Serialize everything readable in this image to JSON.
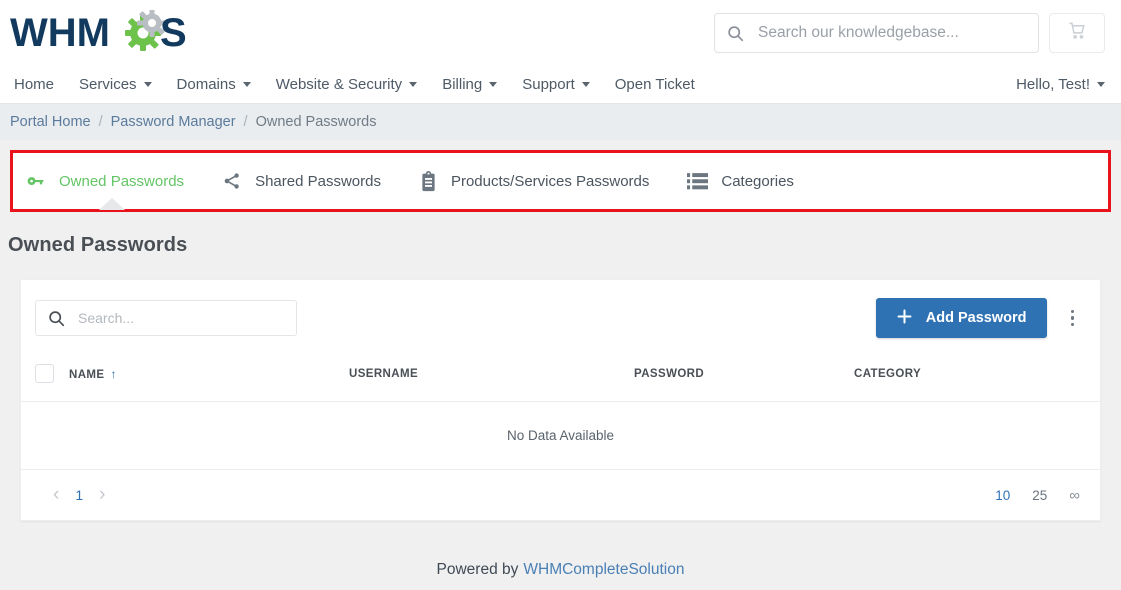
{
  "brand": {
    "logo_text": "WHMCS",
    "logo_navy": "#123a5e",
    "logo_green": "#6cc24a"
  },
  "header": {
    "search": {
      "placeholder": "Search our knowledgebase...",
      "value": "",
      "icon": "search-icon"
    },
    "cart_icon": "shopping-cart-icon"
  },
  "nav": {
    "items": [
      {
        "label": "Home",
        "has_caret": false
      },
      {
        "label": "Services",
        "has_caret": true
      },
      {
        "label": "Domains",
        "has_caret": true
      },
      {
        "label": "Website & Security",
        "has_caret": true
      },
      {
        "label": "Billing",
        "has_caret": true
      },
      {
        "label": "Support",
        "has_caret": true
      },
      {
        "label": "Open Ticket",
        "has_caret": false
      }
    ],
    "account": {
      "label": "Hello, Test!",
      "has_caret": true
    }
  },
  "breadcrumb": {
    "items": [
      {
        "label": "Portal Home",
        "current": false
      },
      {
        "label": "Password Manager",
        "current": false
      },
      {
        "label": "Owned Passwords",
        "current": true
      }
    ],
    "separator": "/"
  },
  "tabs": {
    "highlight_color": "#e8131b",
    "active_color": "#63c565",
    "items": [
      {
        "label": "Owned Passwords",
        "icon": "key-icon",
        "active": true
      },
      {
        "label": "Shared Passwords",
        "icon": "share-icon",
        "active": false
      },
      {
        "label": "Products/Services Passwords",
        "icon": "clipboard-icon",
        "active": false
      },
      {
        "label": "Categories",
        "icon": "list-icon",
        "active": false
      }
    ]
  },
  "main": {
    "title": "Owned Passwords",
    "toolbar": {
      "search": {
        "placeholder": "Search...",
        "value": "",
        "icon": "search-icon"
      },
      "add_button": {
        "label": "Add Password",
        "icon": "plus-icon",
        "color": "#2f72b4"
      },
      "overflow_icon": "kebab-menu-icon"
    },
    "table": {
      "select_all": false,
      "columns": [
        {
          "label": "NAME",
          "sorted": true,
          "sort_arrow": "↑"
        },
        {
          "label": "USERNAME",
          "sorted": false
        },
        {
          "label": "PASSWORD",
          "sorted": false
        },
        {
          "label": "CATEGORY",
          "sorted": false
        }
      ],
      "rows": [],
      "empty_message": "No Data Available"
    },
    "pagination": {
      "prev_icon": "chevron-left-icon",
      "next_icon": "chevron-right-icon",
      "current_page": "1",
      "per_page_options": [
        {
          "label": "10",
          "active": true
        },
        {
          "label": "25",
          "active": false
        },
        {
          "label": "∞",
          "active": false
        }
      ]
    }
  },
  "footer": {
    "prefix": "Powered by",
    "link": "WHMCompleteSolution"
  }
}
